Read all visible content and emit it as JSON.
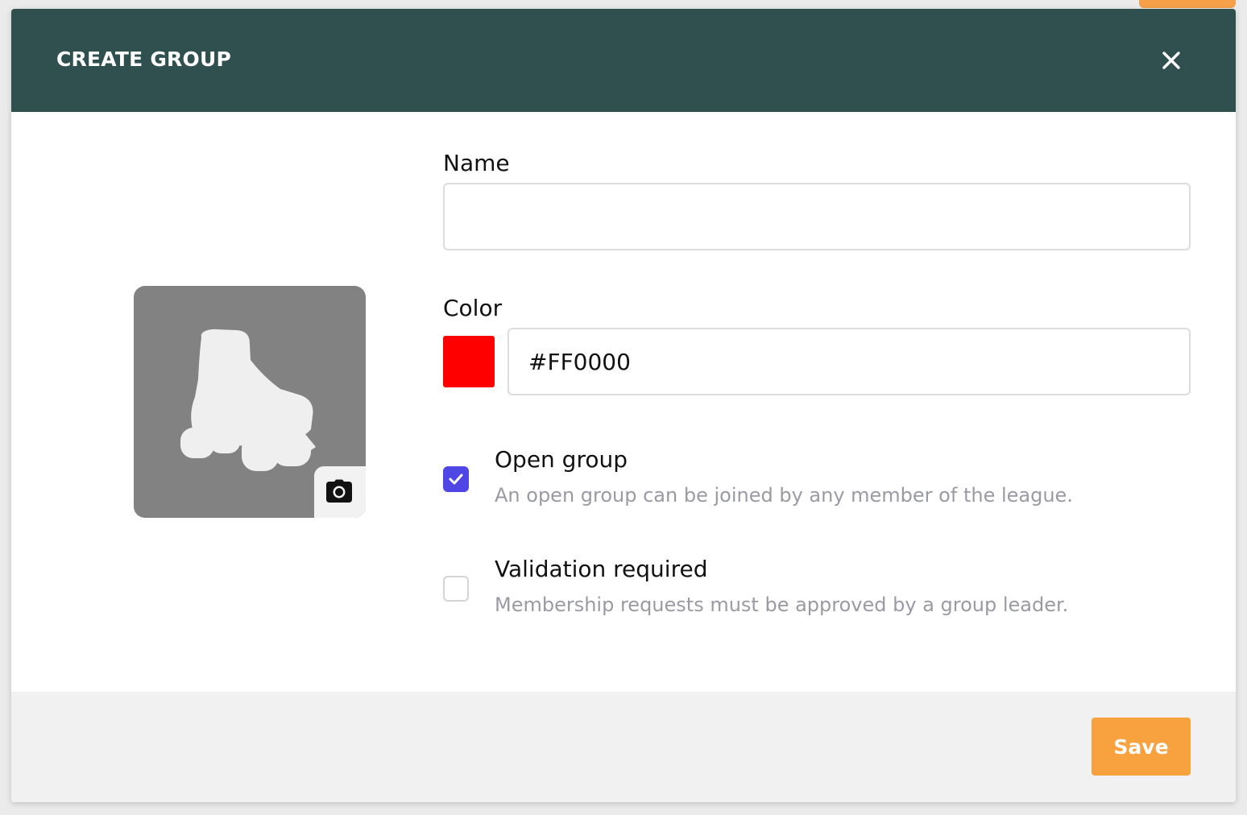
{
  "dialog": {
    "title": "CREATE GROUP",
    "close_icon": "close-icon"
  },
  "avatar": {
    "placeholder_icon": "roller-skate-icon",
    "upload_icon": "camera-icon",
    "background_color": "#828282"
  },
  "form": {
    "name": {
      "label": "Name",
      "value": ""
    },
    "color": {
      "label": "Color",
      "value": "#FF0000",
      "swatch_color": "#FF0000"
    },
    "options": [
      {
        "title": "Open group",
        "description": "An open group can be joined by any member of the league.",
        "checked": true
      },
      {
        "title": "Validation required",
        "description": "Membership requests must be approved by a group leader.",
        "checked": false
      }
    ]
  },
  "footer": {
    "save_label": "Save"
  },
  "colors": {
    "header_bg": "#305050",
    "accent_checkbox": "#4F46E5",
    "save_button": "#F7A23E",
    "footer_bg": "#F1F1F1"
  }
}
